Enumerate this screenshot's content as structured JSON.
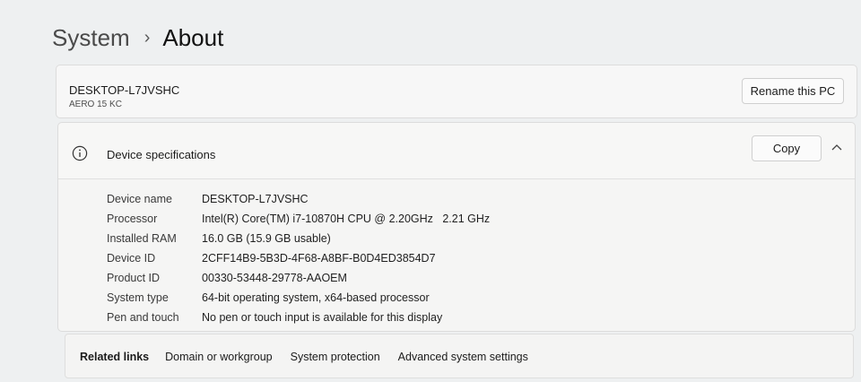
{
  "breadcrumb": {
    "parent": "System",
    "separator": "›",
    "current": "About"
  },
  "pc": {
    "name": "DESKTOP-L7JVSHC",
    "model": "AERO 15 KC",
    "rename_label": "Rename this PC"
  },
  "specs": {
    "title": "Device specifications",
    "copy_label": "Copy",
    "icon": "info-icon",
    "collapse_icon": "chevron-up-icon",
    "rows": [
      {
        "label": "Device name",
        "value": "DESKTOP-L7JVSHC"
      },
      {
        "label": "Processor",
        "value": "Intel(R) Core(TM) i7-10870H CPU @ 2.20GHz   2.21 GHz"
      },
      {
        "label": "Installed RAM",
        "value": "16.0 GB (15.9 GB usable)"
      },
      {
        "label": "Device ID",
        "value": "2CFF14B9-5B3D-4F68-A8BF-B0D4ED3854D7"
      },
      {
        "label": "Product ID",
        "value": "00330-53448-29778-AAOEM"
      },
      {
        "label": "System type",
        "value": "64-bit operating system, x64-based processor"
      },
      {
        "label": "Pen and touch",
        "value": "No pen or touch input is available for this display"
      }
    ]
  },
  "related": {
    "label": "Related links",
    "links": [
      "Domain or workgroup",
      "System protection",
      "Advanced system settings"
    ]
  }
}
